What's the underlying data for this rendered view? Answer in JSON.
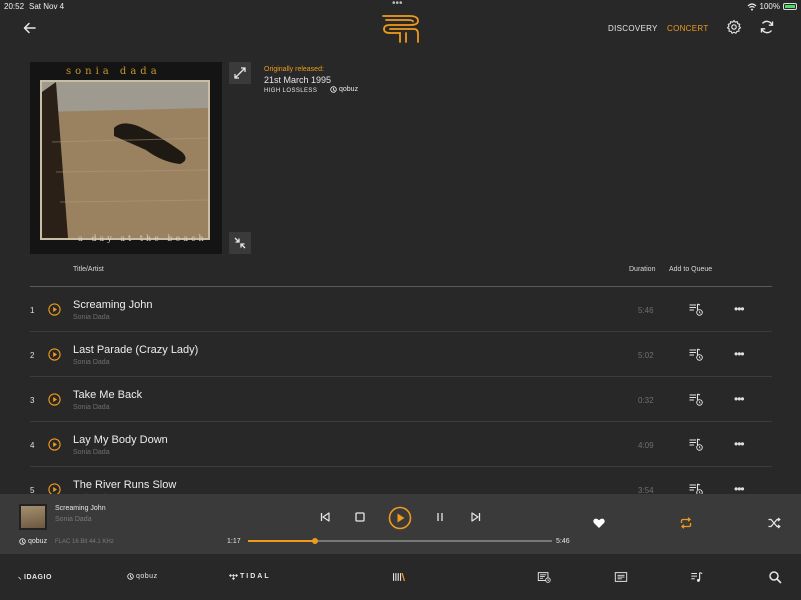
{
  "status": {
    "time": "20:52",
    "date": "Sat Nov 4",
    "battery": "100%"
  },
  "header": {
    "discovery": "DISCOVERY",
    "concert": "CONCERT"
  },
  "album": {
    "cover_title": "sonia dada",
    "cover_subtitle": "a day at the beach",
    "originally_released_label": "Originally released:",
    "release_date": "21st March 1995",
    "quality": "HIGH  LOSSLESS",
    "source": "qobuz"
  },
  "table": {
    "col_title": "Title/Artist",
    "col_duration": "Duration",
    "col_queue": "Add to Queue"
  },
  "tracks": [
    {
      "num": "1",
      "title": "Screaming John",
      "artist": "Sonia Dada",
      "duration": "5:46"
    },
    {
      "num": "2",
      "title": "Last Parade (Crazy Lady)",
      "artist": "Sonia Dada",
      "duration": "5:02"
    },
    {
      "num": "3",
      "title": "Take Me Back",
      "artist": "Sonia Dada",
      "duration": "0:32"
    },
    {
      "num": "4",
      "title": "Lay My Body Down",
      "artist": "Sonia Dada",
      "duration": "4:09"
    },
    {
      "num": "5",
      "title": "The River Runs Slow",
      "artist": "Sonia Dada",
      "duration": "3:54"
    }
  ],
  "player": {
    "title": "Screaming John",
    "artist": "Sonia Dada",
    "source": "qobuz",
    "format": "FLAC 16 Bit 44.1 KHz",
    "current_time": "1:17",
    "total_time": "5:46",
    "progress": 0.22
  },
  "bottom": {
    "idagio": "IDAGIO",
    "qobuz": "qobuz",
    "tidal": "TIDAL"
  },
  "colors": {
    "accent": "#f09a1c",
    "background": "#282828",
    "player_bg": "#3a3a3a"
  }
}
